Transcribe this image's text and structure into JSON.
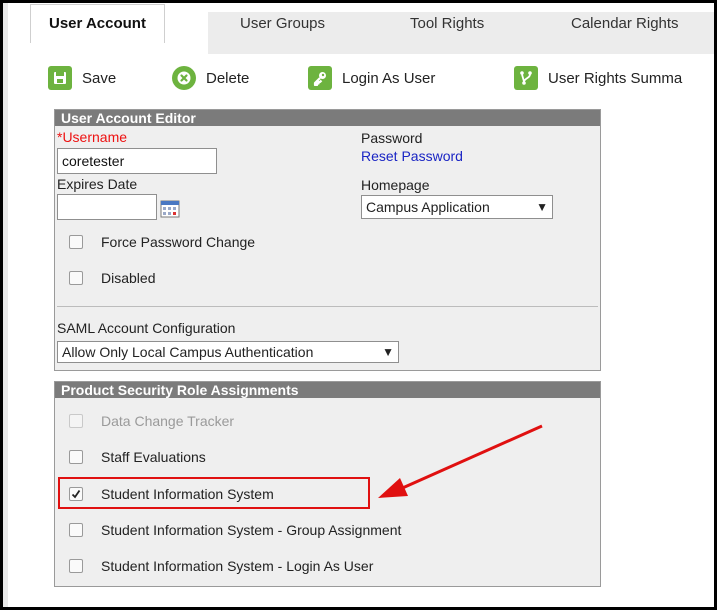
{
  "tabs": [
    {
      "label": "User Account",
      "active": true
    },
    {
      "label": "User Groups"
    },
    {
      "label": "Tool Rights"
    },
    {
      "label": "Calendar Rights"
    }
  ],
  "toolbar": {
    "save_label": "Save",
    "delete_label": "Delete",
    "login_as_user_label": "Login As User",
    "user_rights_summary_label": "User Rights Summa",
    "icon_color": "#6db33f"
  },
  "user_account_editor": {
    "header": "User Account Editor",
    "username_label": "*Username",
    "username_value": "coretester",
    "password_label": "Password",
    "reset_password_link": "Reset Password",
    "expires_date_label": "Expires Date",
    "expires_date_value": "",
    "homepage_label": "Homepage",
    "homepage_value": "Campus Application",
    "force_password_change_label": "Force Password Change",
    "force_password_change_checked": false,
    "disabled_label": "Disabled",
    "disabled_checked": false,
    "saml_label": "SAML Account Configuration",
    "saml_value": "Allow Only Local Campus Authentication"
  },
  "product_security": {
    "header": "Product Security Role Assignments",
    "items": [
      {
        "label": "Data Change Tracker",
        "checked": false,
        "disabled": true
      },
      {
        "label": "Staff Evaluations",
        "checked": false,
        "disabled": false
      },
      {
        "label": "Student Information System",
        "checked": true,
        "disabled": false,
        "highlighted": true
      },
      {
        "label": "Student Information System - Group Assignment",
        "checked": false,
        "disabled": false
      },
      {
        "label": "Student Information System - Login As User",
        "checked": false,
        "disabled": false
      }
    ]
  },
  "colors": {
    "header_bg": "#7b7b7b",
    "panel_bg": "#efefef",
    "required": "#e11111",
    "link": "#1a25c4",
    "highlight": "#e01010"
  }
}
